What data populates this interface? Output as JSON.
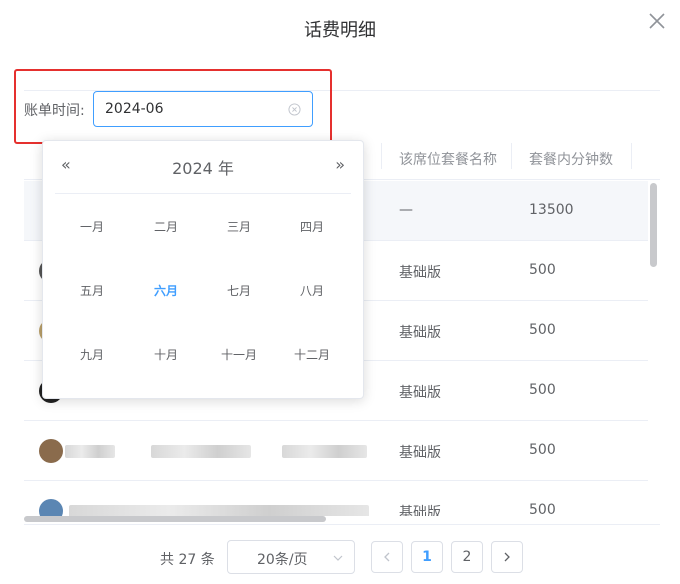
{
  "dialog": {
    "title": "话费明细"
  },
  "filter": {
    "label": "账单时间:",
    "value": "2024-06"
  },
  "table": {
    "columns": [
      "该席位套餐名称",
      "套餐内分钟数"
    ],
    "rows": [
      {
        "plan": "—",
        "minutes": "13500"
      },
      {
        "plan": "基础版",
        "minutes": "500"
      },
      {
        "plan": "基础版",
        "minutes": "500"
      },
      {
        "plan": "基础版",
        "minutes": "500"
      },
      {
        "plan": "基础版",
        "minutes": "500"
      },
      {
        "plan": "基础版",
        "minutes": "500"
      }
    ]
  },
  "pagination": {
    "total": "共 27 条",
    "page_size": "20条/页",
    "pages": [
      "1",
      "2"
    ],
    "current": "1"
  },
  "picker": {
    "prev": "«",
    "next": "»",
    "year": "2024 年",
    "months": [
      "一月",
      "二月",
      "三月",
      "四月",
      "五月",
      "六月",
      "七月",
      "八月",
      "九月",
      "十月",
      "十一月",
      "十二月"
    ],
    "selected_index": 5
  },
  "colors": {
    "accent": "#409eff",
    "highlight_border": "#e5302e"
  }
}
